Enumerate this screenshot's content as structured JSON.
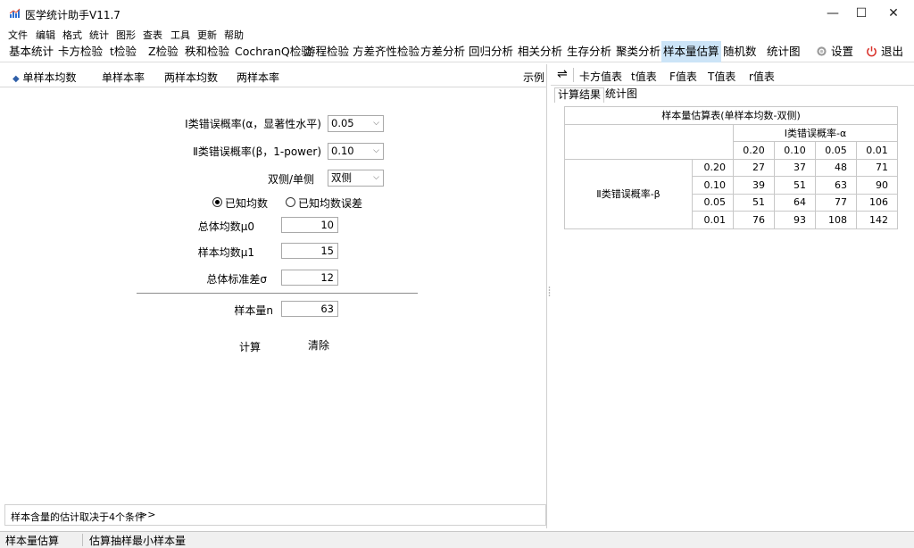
{
  "window": {
    "title": "医学统计助手V11.7",
    "minimize": "—",
    "maximize": "☐",
    "close": "✕"
  },
  "menu": [
    "文件",
    "编辑",
    "格式",
    "统计",
    "图形",
    "查表",
    "工具",
    "更新",
    "帮助"
  ],
  "toolbar": {
    "items": [
      "基本统计",
      "卡方检验",
      "t检验",
      "Z检验",
      "秩和检验",
      "CochranQ检验",
      "游程检验",
      "方差齐性检验",
      "方差分析",
      "回归分析",
      "相关分析",
      "生存分析",
      "聚类分析",
      "样本量估算",
      "随机数",
      "统计图"
    ],
    "active": "样本量估算",
    "settings_label": "设置",
    "exit_label": "退出"
  },
  "left": {
    "tabs": [
      "单样本均数",
      "单样本率",
      "两样本均数",
      "两样本率"
    ],
    "selected_tab": "单样本均数",
    "example_link": "示例",
    "alpha_label": "Ⅰ类错误概率(α，显著性水平)",
    "alpha_value": "0.05",
    "beta_label": "Ⅱ类错误概率(β，1-power)",
    "beta_value": "0.10",
    "sides_label": "双侧/单侧",
    "sides_value": "双侧",
    "radio_known_mean": "已知均数",
    "radio_known_error": "已知均数误差",
    "radio_selected": "已知均数",
    "mu0_label": "总体均数μ0",
    "mu0_value": "10",
    "mu1_label": "样本均数μ1",
    "mu1_value": "15",
    "sigma_label": "总体标准差σ",
    "sigma_value": "12",
    "n_label": "样本量n",
    "n_value": "63",
    "calc_button": "计算",
    "clear_button": "清除",
    "hint_text": "样本含量的估计取决于4个条件",
    "hint_more": ">>"
  },
  "right": {
    "swap_icon": "⇌",
    "tabs": [
      "卡方值表",
      "t值表",
      "F值表",
      "T值表",
      "r值表"
    ],
    "subtabs": [
      "计算结果",
      "统计图"
    ],
    "active_subtab": "计算结果",
    "table": {
      "title": "样本量估算表(单样本均数-双侧)",
      "alpha_header": "Ⅰ类错误概率-α",
      "beta_header": "Ⅱ类错误概率-β",
      "alpha_values": [
        "0.20",
        "0.10",
        "0.05",
        "0.01"
      ],
      "rows": [
        {
          "beta": "0.20",
          "values": [
            "27",
            "37",
            "48",
            "71"
          ]
        },
        {
          "beta": "0.10",
          "values": [
            "39",
            "51",
            "63",
            "90"
          ]
        },
        {
          "beta": "0.05",
          "values": [
            "51",
            "64",
            "77",
            "106"
          ]
        },
        {
          "beta": "0.01",
          "values": [
            "76",
            "93",
            "108",
            "142"
          ]
        }
      ]
    }
  },
  "status": {
    "left": "样本量估算",
    "right": "估算抽样最小样本量"
  },
  "colors": {
    "active_toolbar": "#cce4f7",
    "exit_icon": "#d9312a",
    "settings_icon": "#8a8a8a"
  }
}
